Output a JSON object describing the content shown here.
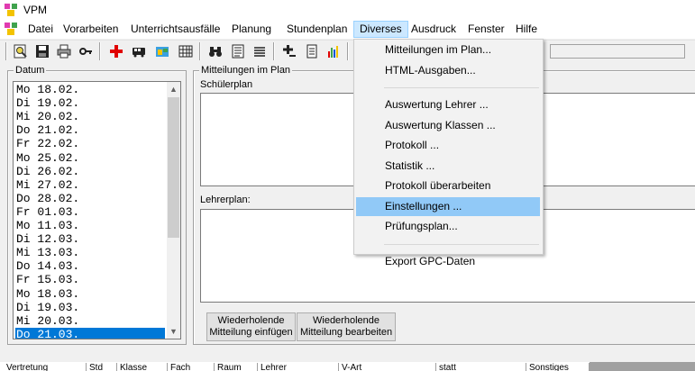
{
  "window": {
    "title": "VPM"
  },
  "menubar": {
    "items": [
      {
        "label": "Datei"
      },
      {
        "label": "Vorarbeiten"
      },
      {
        "label": "Unterrichtsausfälle"
      },
      {
        "label": "Planung"
      },
      {
        "label": "Stundenplan"
      },
      {
        "label": "Diverses",
        "active": true
      },
      {
        "label": "Ausdruck"
      },
      {
        "label": "Fenster"
      },
      {
        "label": "Hilfe"
      }
    ]
  },
  "toolbar": {
    "icons": [
      "search-icon",
      "save-icon",
      "print-icon",
      "key-icon",
      "add-red-icon",
      "bus-icon",
      "schedule-icon",
      "grid-icon",
      "binoculars-icon",
      "list-icon",
      "lines-icon",
      "add-minus-icon",
      "document-icon",
      "chart-icon"
    ]
  },
  "datum": {
    "label": "Datum",
    "dates": [
      "Mo 18.02.",
      "Di 19.02.",
      "Mi 20.02.",
      "Do 21.02.",
      "Fr 22.02.",
      "Mo 25.02.",
      "Di 26.02.",
      "Mi 27.02.",
      "Do 28.02.",
      "Fr 01.03.",
      "Mo 11.03.",
      "Di 12.03.",
      "Mi 13.03.",
      "Do 14.03.",
      "Fr 15.03.",
      "Mo 18.03.",
      "Di 19.03.",
      "Mi 20.03.",
      "Do 21.03."
    ],
    "selected_index": 18
  },
  "mitteilungen": {
    "label": "Mitteilungen im Plan",
    "schuelerplan_label": "Schülerplan",
    "lehrerplan_label": "Lehrerplan:",
    "btn_einfuegen": {
      "line1": "Wiederholende",
      "line2": "Mitteilung einfügen"
    },
    "btn_bearbeiten": {
      "line1": "Wiederholende",
      "line2": "Mitteilung bearbeiten"
    }
  },
  "bottom_table": {
    "columns": [
      "Vertretung",
      "Std",
      "Klasse",
      "Fach",
      "Raum",
      "Lehrer",
      "V-Art",
      "statt",
      "Sonstiges"
    ]
  },
  "dropdown": {
    "items": [
      {
        "label": "Mitteilungen im Plan..."
      },
      {
        "label": "HTML-Ausgaben..."
      },
      {
        "separator": true
      },
      {
        "label": "Auswertung Lehrer ..."
      },
      {
        "label": "Auswertung Klassen ..."
      },
      {
        "label": "Protokoll ..."
      },
      {
        "label": "Statistik ..."
      },
      {
        "label": "Protokoll überarbeiten"
      },
      {
        "label": "Einstellungen ...",
        "highlighted": true
      },
      {
        "label": "Prüfungsplan..."
      },
      {
        "separator": true
      },
      {
        "label": "Export GPC-Daten"
      }
    ]
  },
  "colors": {
    "selection": "#0078d7",
    "menu_active": "#cce8ff",
    "menu_highlight": "#91c9f7"
  }
}
